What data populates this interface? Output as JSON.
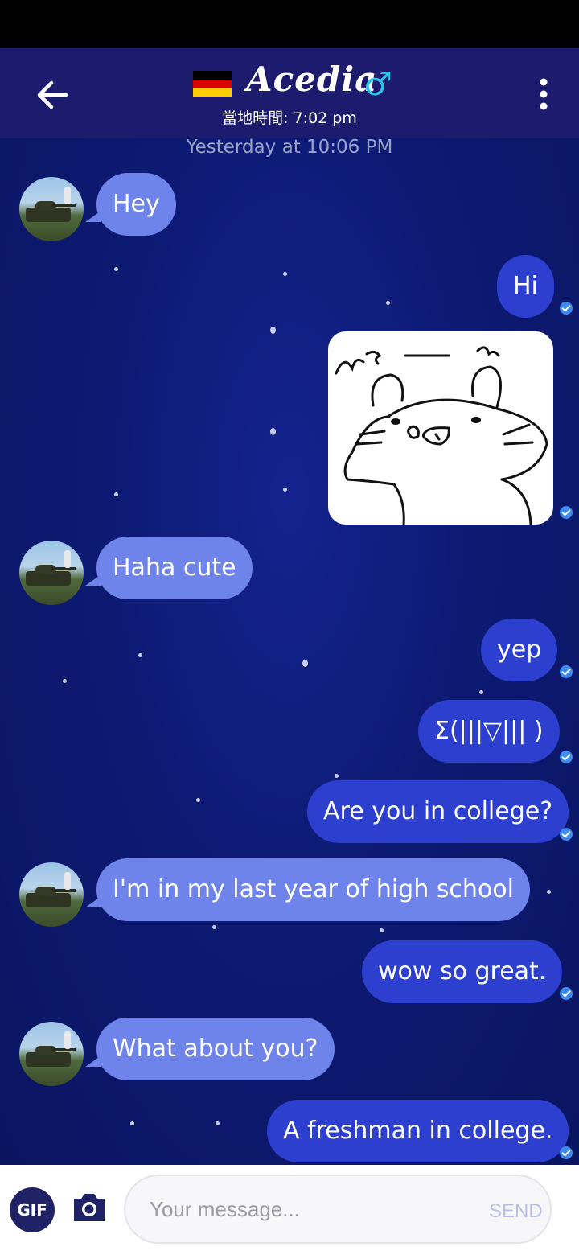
{
  "header": {
    "back_icon": "arrow-left-icon",
    "flag": "germany-flag",
    "flag_colors": [
      "#000000",
      "#dd0000",
      "#ffce00"
    ],
    "contact_name": "Acedia",
    "gender_symbol": "♂",
    "local_time": "當地時間: 7:02 pm",
    "menu_icon": "more-vertical-icon"
  },
  "chat": {
    "date_separator": "Yesterday at 10:06 PM",
    "messages": [
      {
        "sender": "them",
        "type": "text",
        "text": "Hey"
      },
      {
        "sender": "me",
        "type": "text",
        "text": "Hi",
        "read": true
      },
      {
        "sender": "me",
        "type": "sticker",
        "sticker": "hamster-sticker",
        "read": true
      },
      {
        "sender": "them",
        "type": "text",
        "text": "Haha cute"
      },
      {
        "sender": "me",
        "type": "text",
        "text": "yep",
        "read": true
      },
      {
        "sender": "me",
        "type": "text",
        "text": "Σ(|||▽||| )",
        "read": true
      },
      {
        "sender": "me",
        "type": "text",
        "text": "Are you in college?",
        "read": true
      },
      {
        "sender": "them",
        "type": "text",
        "text": "I'm in my last year of high school"
      },
      {
        "sender": "me",
        "type": "text",
        "text": "wow so great.",
        "read": true
      },
      {
        "sender": "them",
        "type": "text",
        "text": "What about you?"
      },
      {
        "sender": "me",
        "type": "text",
        "text": "A freshman in college.",
        "read": true
      }
    ]
  },
  "composer": {
    "gif_label": "GIF",
    "camera_icon": "camera-icon",
    "placeholder": "Your message...",
    "value": "",
    "send_label": "SEND"
  },
  "colors": {
    "header_bg": "#1c1b6e",
    "incoming_bubble": "#6f84ea",
    "outgoing_bubble": "#2c3fcf",
    "read_check": "#3d8bf0",
    "gender_color": "#29c3e8"
  }
}
